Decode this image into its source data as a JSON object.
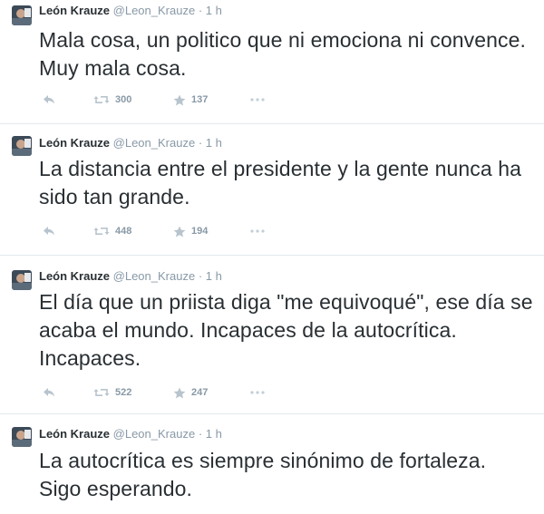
{
  "colors": {
    "name": "#292f33",
    "muted": "#8899a6",
    "icon": "#b8c4cd",
    "divider": "#e1e8ed"
  },
  "tweets": [
    {
      "fullname": "León Krauze",
      "username": "@Leon_Krauze",
      "separator": "·",
      "time": "1 h",
      "text": "Mala cosa, un politico que ni emociona ni convence. Muy mala cosa.",
      "retweets": "300",
      "favorites": "137",
      "icons": [
        "reply-icon",
        "retweet-icon",
        "favorite-icon",
        "more-icon"
      ]
    },
    {
      "fullname": "León Krauze",
      "username": "@Leon_Krauze",
      "separator": "·",
      "time": "1 h",
      "text": "La distancia entre el presidente y la gente nunca ha sido tan grande.",
      "retweets": "448",
      "favorites": "194",
      "icons": [
        "reply-icon",
        "retweet-icon",
        "favorite-icon",
        "more-icon"
      ]
    },
    {
      "fullname": "León Krauze",
      "username": "@Leon_Krauze",
      "separator": "·",
      "time": "1 h",
      "text": "El día que un priista diga \"me equivoqué\", ese día se acaba el mundo. Incapaces de la autocrítica. Incapaces.",
      "retweets": "522",
      "favorites": "247",
      "icons": [
        "reply-icon",
        "retweet-icon",
        "favorite-icon",
        "more-icon"
      ]
    },
    {
      "fullname": "León Krauze",
      "username": "@Leon_Krauze",
      "separator": "·",
      "time": "1 h",
      "text": "La autocrítica es siempre sinónimo de fortaleza. Sigo esperando."
    }
  ]
}
